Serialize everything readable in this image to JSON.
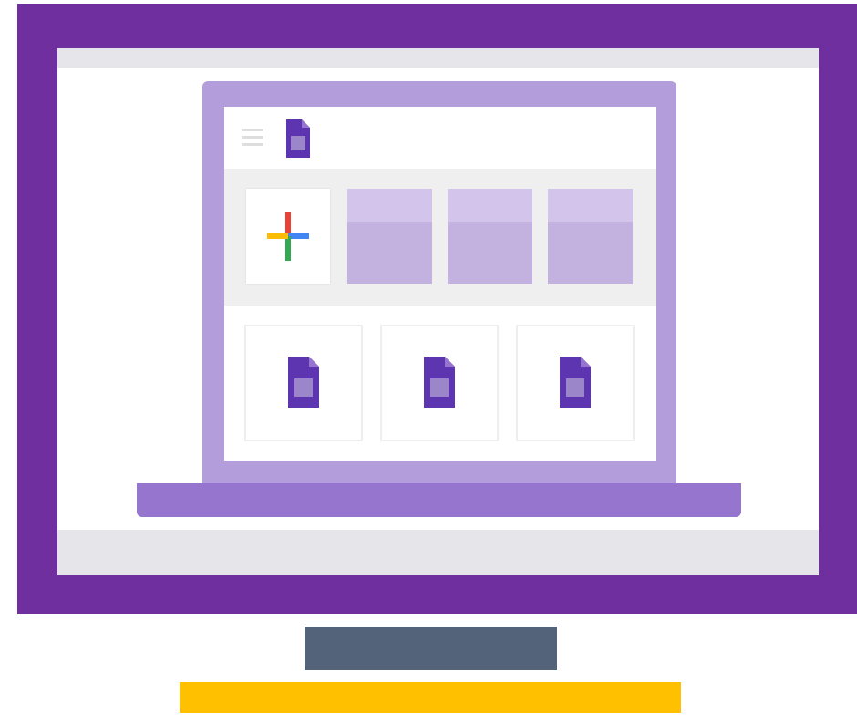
{
  "illustration": {
    "colors": {
      "frame": "#6f2f9f",
      "laptop_lid": "#b39ddb",
      "laptop_base": "#9575cd",
      "doc_icon": "#5e35b1",
      "template_tile": "#c3b2e0",
      "stand_bar": "#52637a",
      "accent_bar": "#ffc000"
    },
    "header": {
      "menu_icon": "hamburger-menu-icon",
      "app_icon": "docs-file-icon"
    },
    "new_tile": {
      "icon": "plus-icon",
      "plus_colors": [
        "#ea4335",
        "#4285f4",
        "#34a853",
        "#fbbc04"
      ]
    },
    "template_tiles": 3,
    "document_cards": 3
  }
}
